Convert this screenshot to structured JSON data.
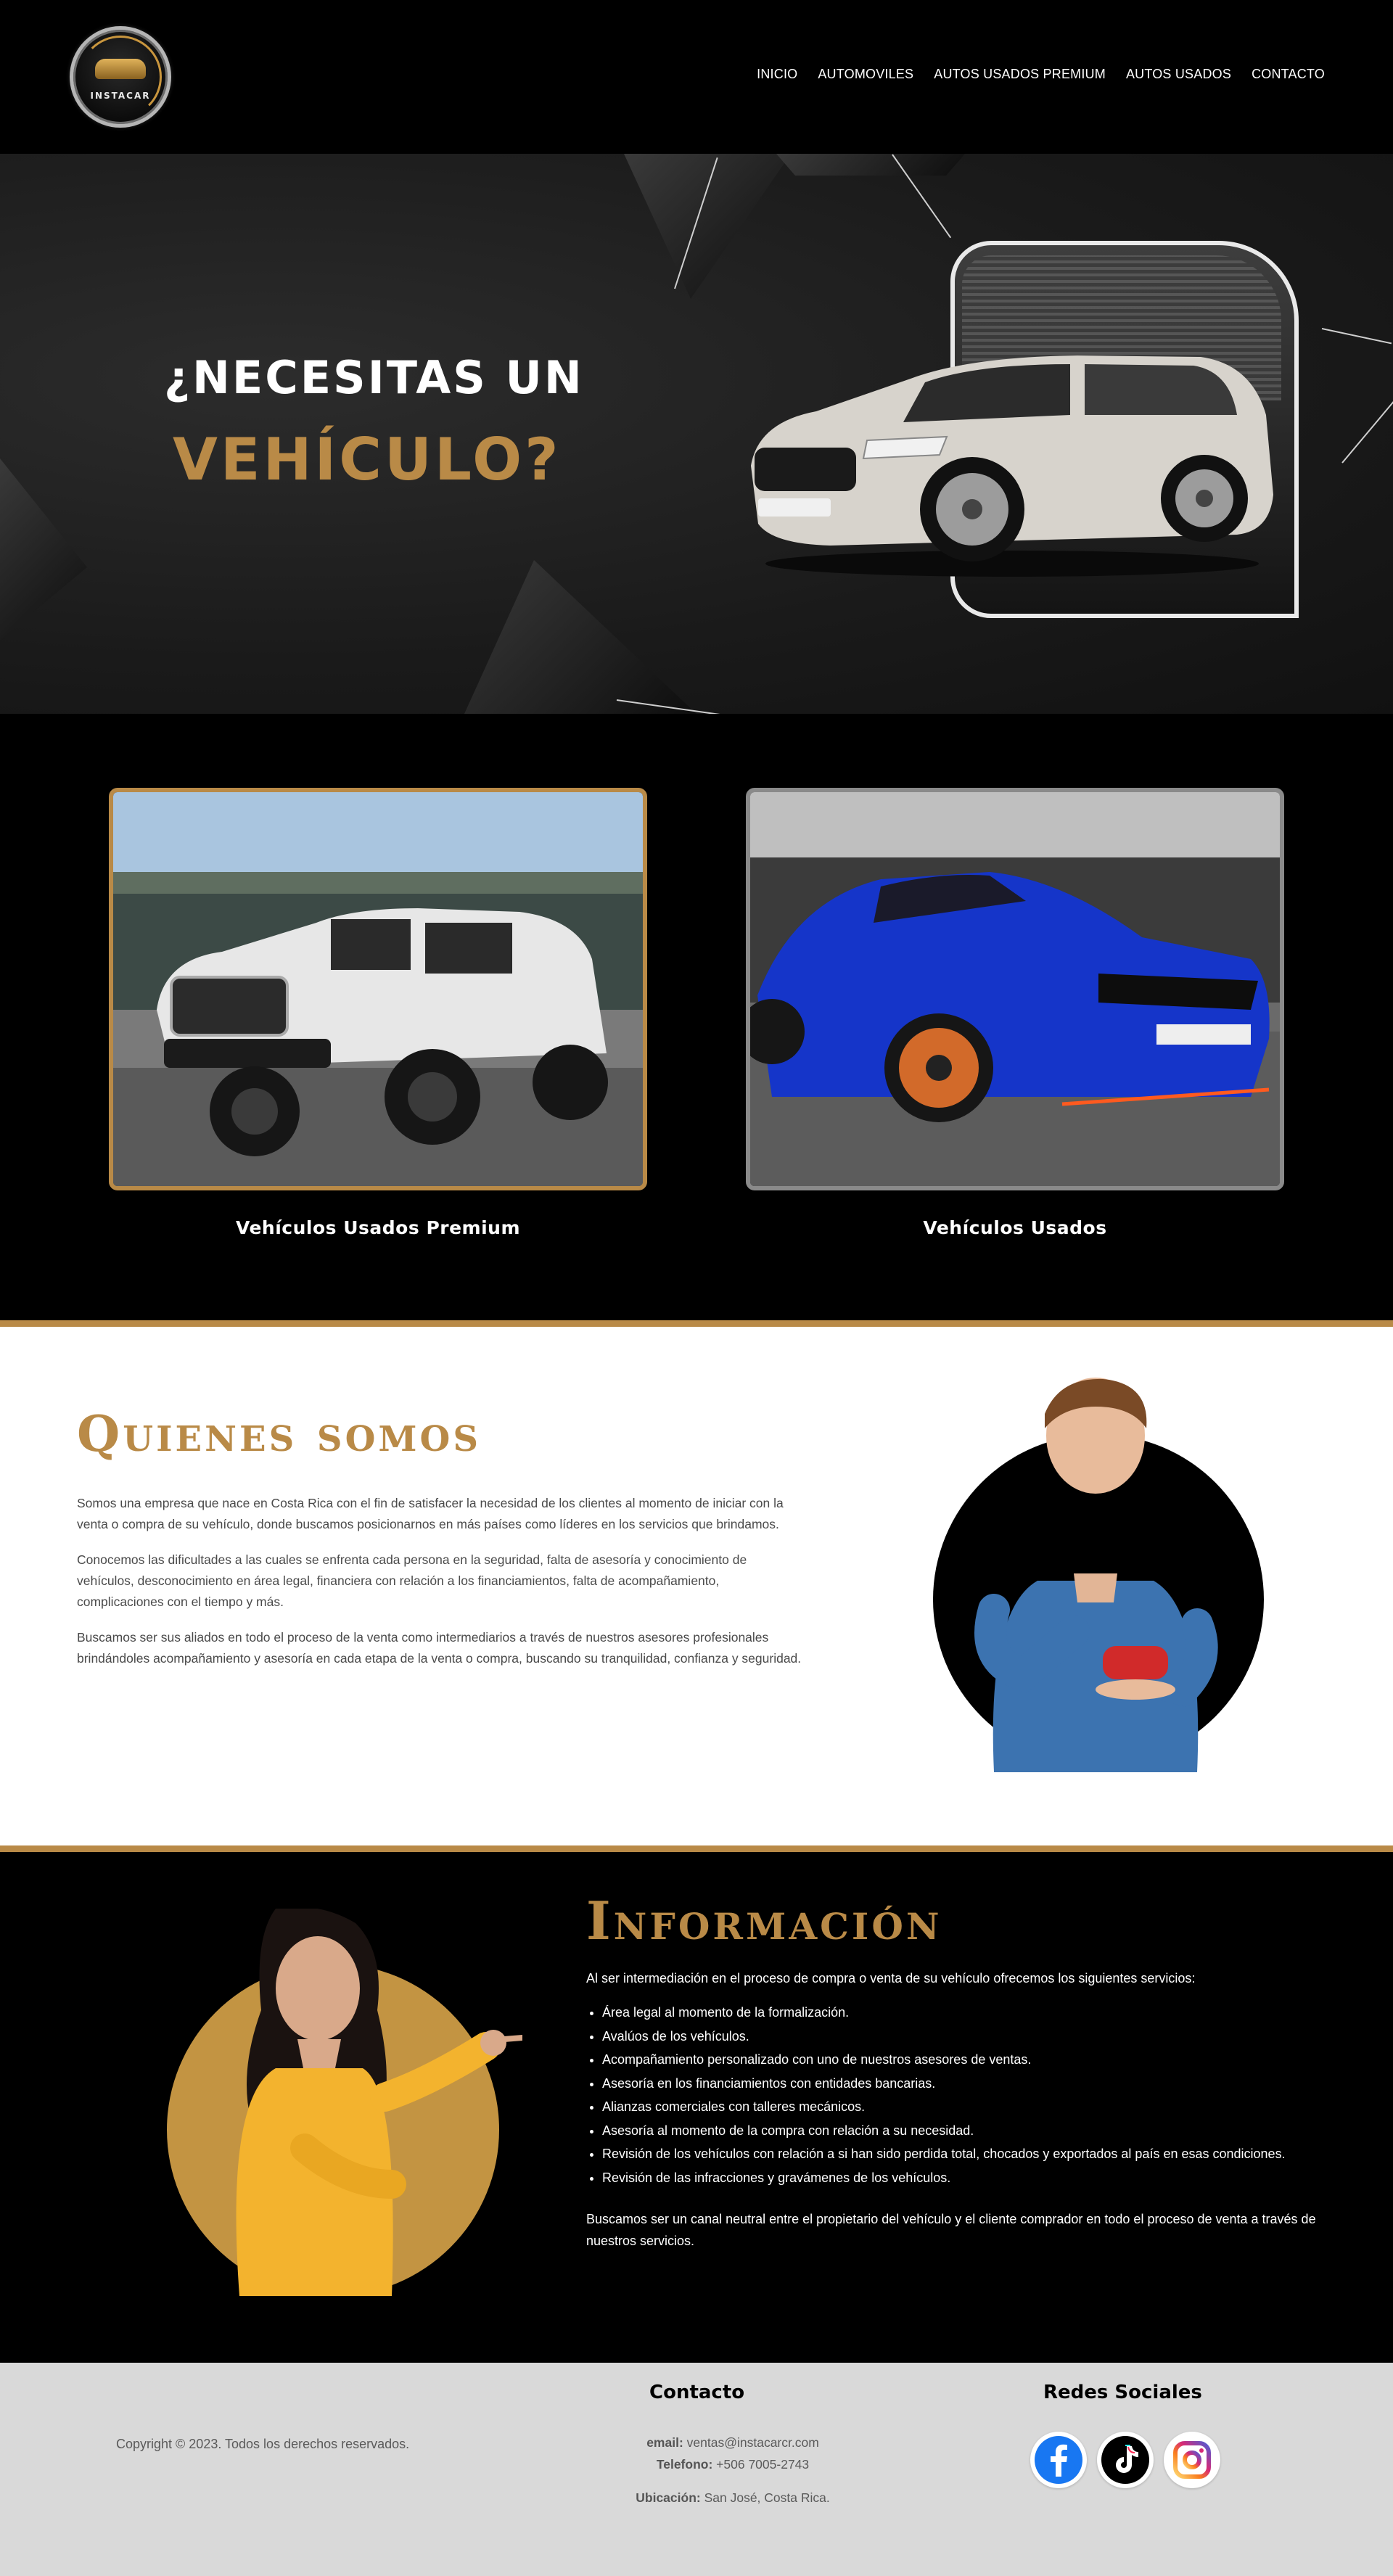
{
  "header": {
    "logo_text": "INSTACAR",
    "nav": [
      "INICIO",
      "AUTOMOVILES",
      "AUTOS USADOS PREMIUM",
      "AUTOS USADOS",
      "CONTACTO"
    ]
  },
  "hero": {
    "title_line1": "¿NECESITAS UN",
    "title_line2": "VEHÍCULO?"
  },
  "cards": [
    {
      "label": "Vehículos Usados Premium"
    },
    {
      "label": "Vehículos Usados"
    }
  ],
  "about": {
    "title": "Quienes somos",
    "paragraphs": [
      "Somos una empresa que nace en Costa Rica con el fin de satisfacer la necesidad de los clientes al momento de iniciar con la venta o compra de su vehículo, donde buscamos posicionarnos en más países como líderes en los servicios que brindamos.",
      "Conocemos las dificultades a las cuales se enfrenta cada persona en la seguridad, falta de asesoría y conocimiento de vehículos, desconocimiento en área legal, financiera con relación a los financiamientos, falta de acompañamiento, complicaciones con el tiempo y más.",
      "Buscamos ser sus aliados en todo el proceso de la venta como intermediarios a través de nuestros asesores profesionales brindándoles acompañamiento y asesoría en cada etapa de la venta o compra, buscando su tranquilidad, confianza y seguridad."
    ]
  },
  "info": {
    "title": "Información",
    "lead": "Al ser intermediación en el proceso de compra o venta de su vehículo ofrecemos los siguientes servicios:",
    "services": [
      "Área legal al momento de la formalización.",
      "Avalúos de los vehículos.",
      "Acompañamiento personalizado con uno de nuestros asesores de ventas.",
      "Asesoría en los financiamientos con entidades bancarias.",
      "Alianzas comerciales con talleres mecánicos.",
      "Asesoría al momento de la compra con relación a su necesidad.",
      "Revisión de los vehículos con relación a si han sido perdida total, chocados y exportados al país en esas condiciones.",
      "Revisión de las infracciones y gravámenes de los vehículos."
    ],
    "closing": "Buscamos ser un canal neutral entre el propietario del vehículo y el cliente comprador en todo el proceso de venta a través de nuestros servicios."
  },
  "footer": {
    "copyright": "Copyright © 2023. Todos los derechos reservados.",
    "contact_title": "Contacto",
    "email_label": "email:",
    "email": "ventas@instacarcr.com",
    "phone_label": "Telefono:",
    "phone": "+506 7005-2743",
    "location_label": "Ubicación:",
    "location": "San José, Costa Rica.",
    "social_title": "Redes Sociales",
    "social_icons": [
      "facebook-icon",
      "tiktok-icon",
      "instagram-icon"
    ],
    "colors": {
      "brand_gold": "#b98a47",
      "facebook": "#1877f2",
      "instagram": "#c13584"
    }
  }
}
